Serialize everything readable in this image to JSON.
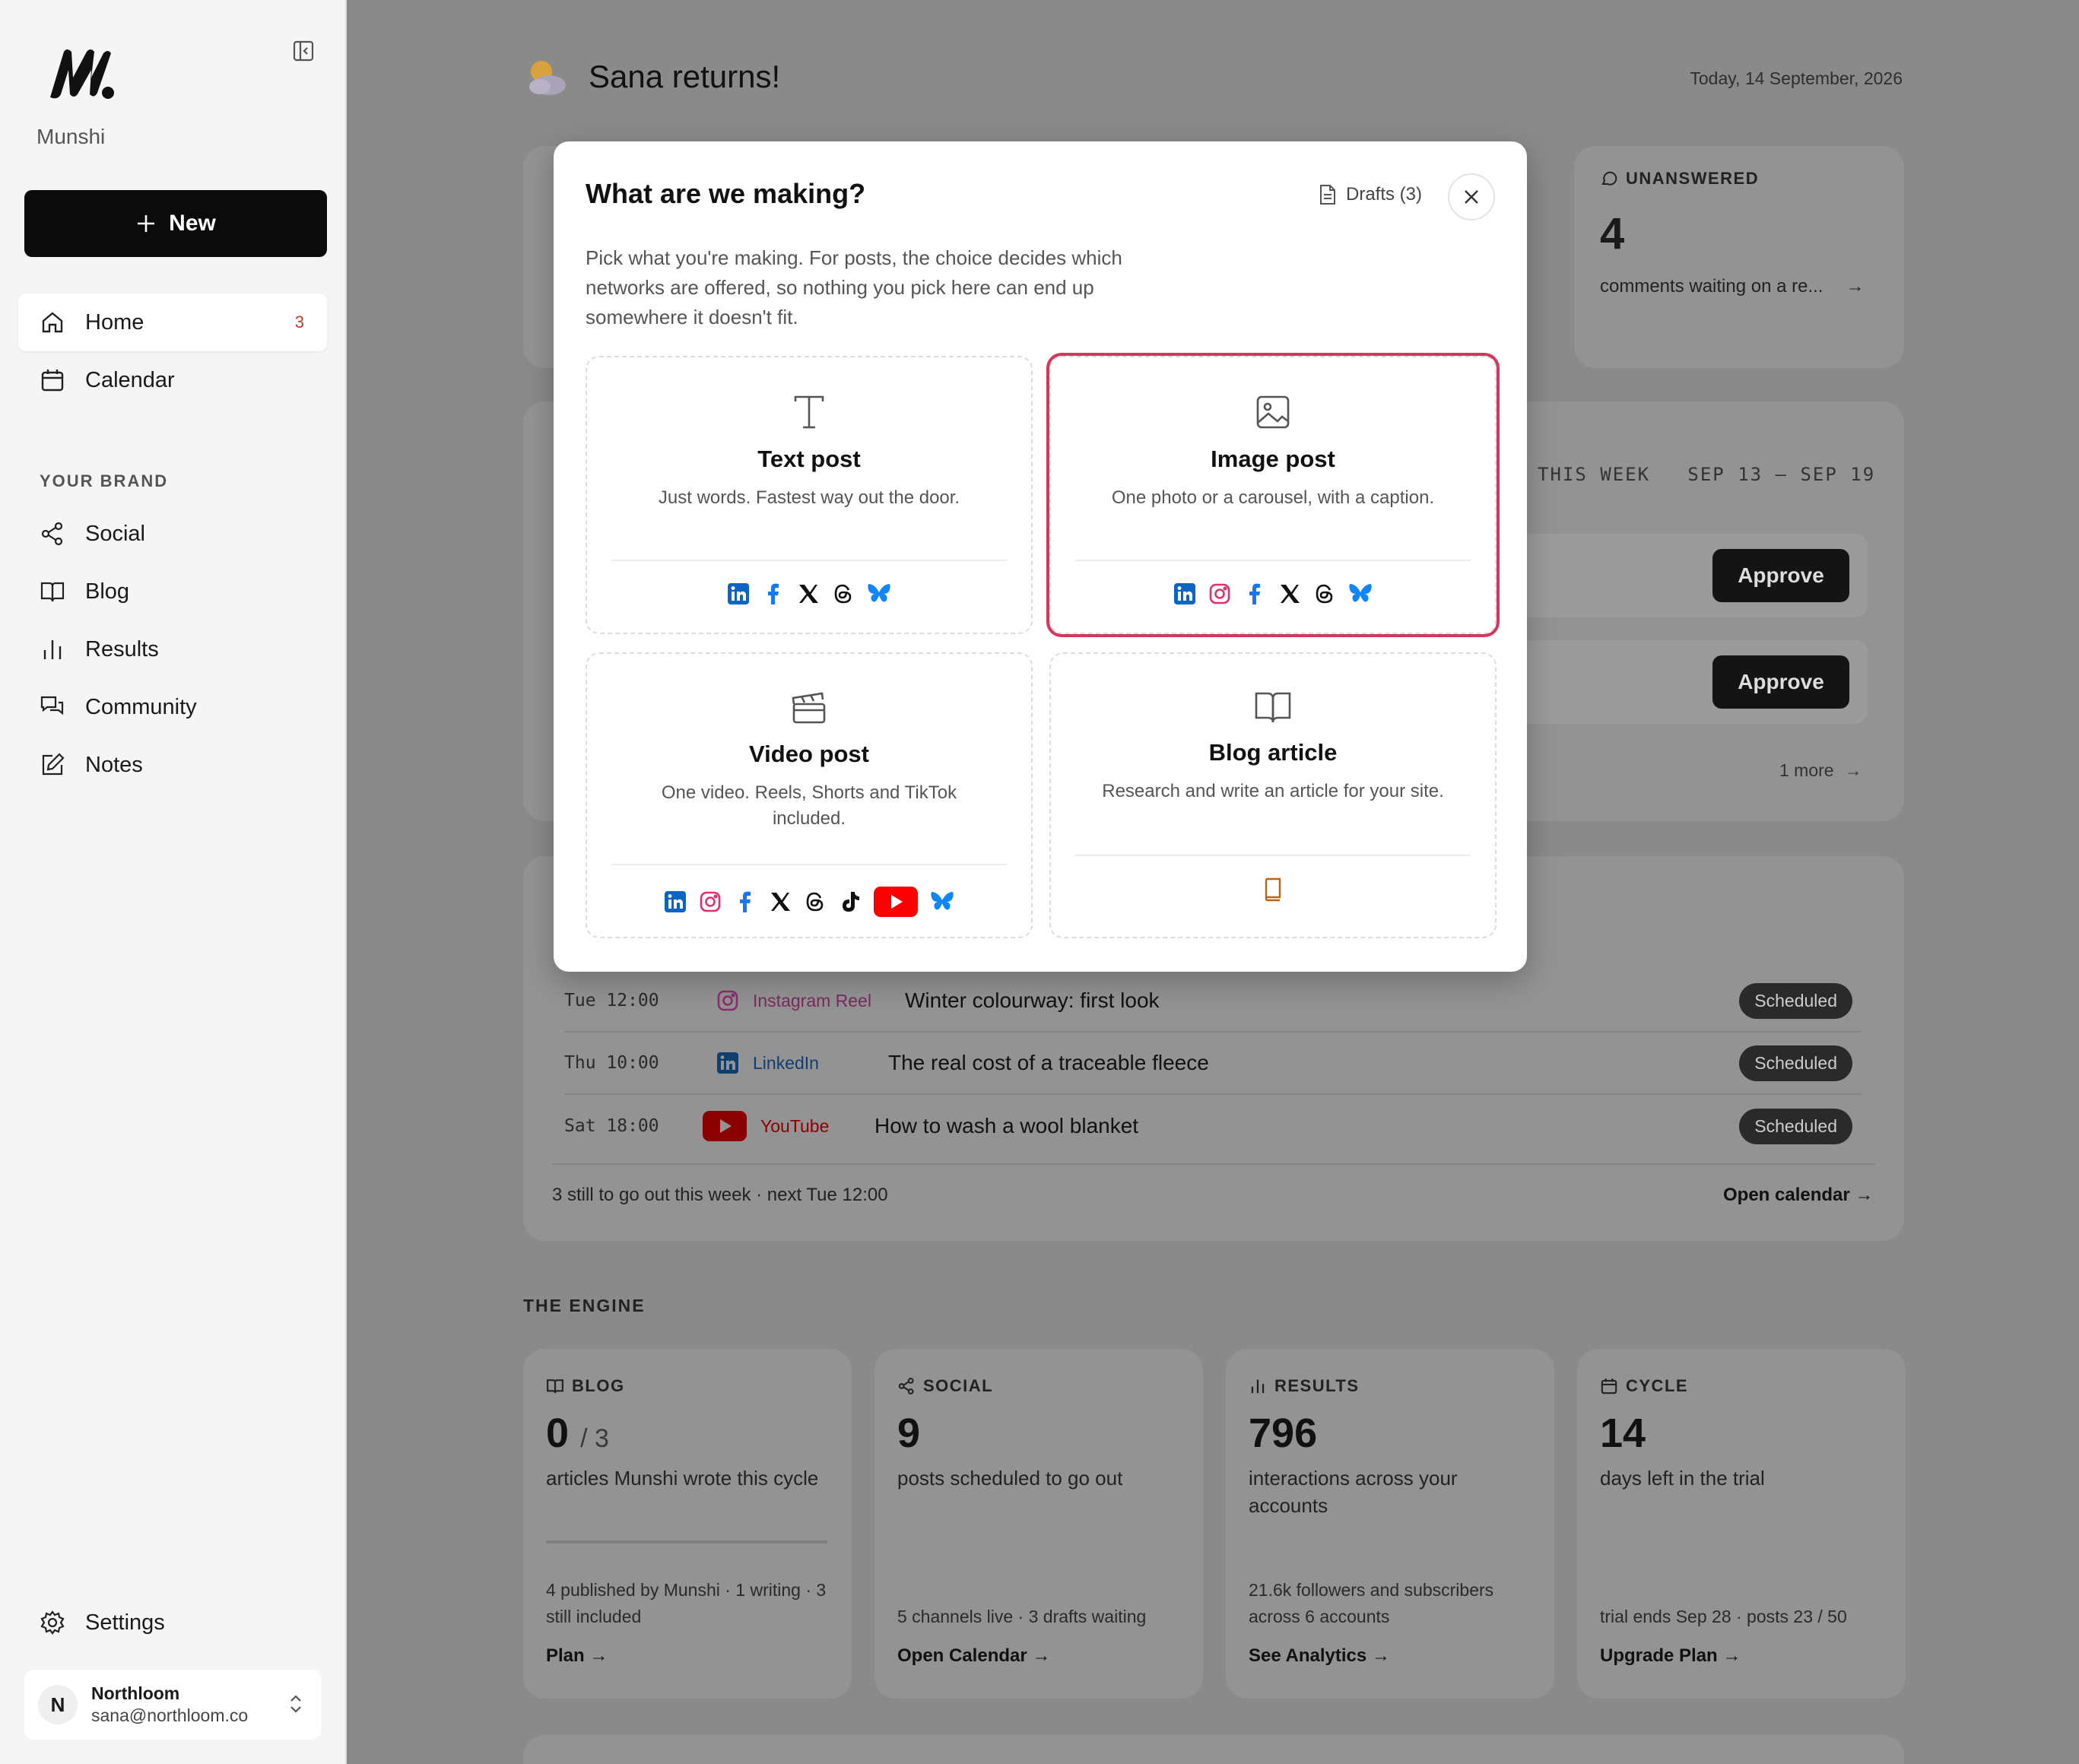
{
  "sidebar": {
    "brand": "Munshi",
    "new_label": "New",
    "nav": [
      {
        "label": "Home",
        "badge": "3"
      },
      {
        "label": "Calendar"
      }
    ],
    "section": "YOUR BRAND",
    "brand_nav": [
      {
        "label": "Social"
      },
      {
        "label": "Blog"
      },
      {
        "label": "Results"
      },
      {
        "label": "Community"
      },
      {
        "label": "Notes"
      }
    ],
    "settings": "Settings",
    "account": {
      "initial": "N",
      "name": "Northloom",
      "email": "sana@northloom.co"
    }
  },
  "header": {
    "greeting": "Sana returns!",
    "date": "Today, 14 September, 2026"
  },
  "unanswered": {
    "label": "UNANSWERED",
    "count": "4",
    "sub": "comments waiting on a re..."
  },
  "week": {
    "label": "THIS WEEK",
    "range": "SEP 13 – SEP 19"
  },
  "approve_label": "Approve",
  "more_label": "1 more",
  "schedule": {
    "rows": [
      {
        "time": "Tue 12:00",
        "network": "Instagram Reel",
        "title": "Winter colourway: first look",
        "status": "Scheduled",
        "color": "#8a2f6c"
      },
      {
        "time": "Thu 10:00",
        "network": "LinkedIn",
        "title": "The real cost of a traceable fleece",
        "status": "Scheduled",
        "color": "#103e6e"
      },
      {
        "time": "Sat 18:00",
        "network": "YouTube",
        "title": "How to wash a wool blanket",
        "status": "Scheduled",
        "color": "#8b0000"
      }
    ],
    "footer": "3 still to go out this week · next Tue 12:00",
    "open_calendar": "Open calendar →"
  },
  "engine": {
    "label": "THE ENGINE",
    "cards": [
      {
        "label": "BLOG",
        "value": "0",
        "value_suffix": "/ 3",
        "desc": "articles Munshi wrote this cycle",
        "foot": "4 published by Munshi · 1 writing · 3 still included",
        "link": "Plan →"
      },
      {
        "label": "SOCIAL",
        "value": "9",
        "desc": "posts scheduled to go out",
        "foot": "5 channels live · 3 drafts waiting",
        "link": "Open Calendar →"
      },
      {
        "label": "RESULTS",
        "value": "796",
        "desc": "interactions across your accounts",
        "foot": "21.6k followers and subscribers across 6 accounts",
        "link": "See Analytics →"
      },
      {
        "label": "CYCLE",
        "value": "14",
        "desc": "days left in the trial",
        "foot": "trial ends Sep 28 · posts 23 / 50",
        "link": "Upgrade Plan →"
      }
    ]
  },
  "modal": {
    "title": "What are we making?",
    "drafts": "Drafts (3)",
    "description": "Pick what you're making. For posts, the choice decides which networks are offered, so nothing you pick here can end up somewhere it doesn't fit.",
    "options": [
      {
        "title": "Text post",
        "desc": "Just words. Fastest way out the door.",
        "networks": [
          "linkedin",
          "facebook",
          "x",
          "threads",
          "bluesky"
        ],
        "selected": false
      },
      {
        "title": "Image post",
        "desc": "One photo or a carousel, with a caption.",
        "networks": [
          "linkedin",
          "instagram",
          "facebook",
          "x",
          "threads",
          "bluesky"
        ],
        "selected": true
      },
      {
        "title": "Video post",
        "desc": "One video. Reels, Shorts and TikTok included.",
        "networks": [
          "linkedin",
          "instagram",
          "facebook",
          "x",
          "threads",
          "tiktok",
          "youtube",
          "bluesky"
        ],
        "selected": false
      },
      {
        "title": "Blog article",
        "desc": "Research and write an article for your site.",
        "networks": [
          "blog"
        ],
        "selected": false
      }
    ]
  },
  "colors": {
    "selected_border": "#d6355d",
    "linkedin": "#0a66c2",
    "instagram": "#e1306c",
    "facebook": "#1877f2",
    "youtube": "#ff0000",
    "bluesky": "#1185fe"
  }
}
